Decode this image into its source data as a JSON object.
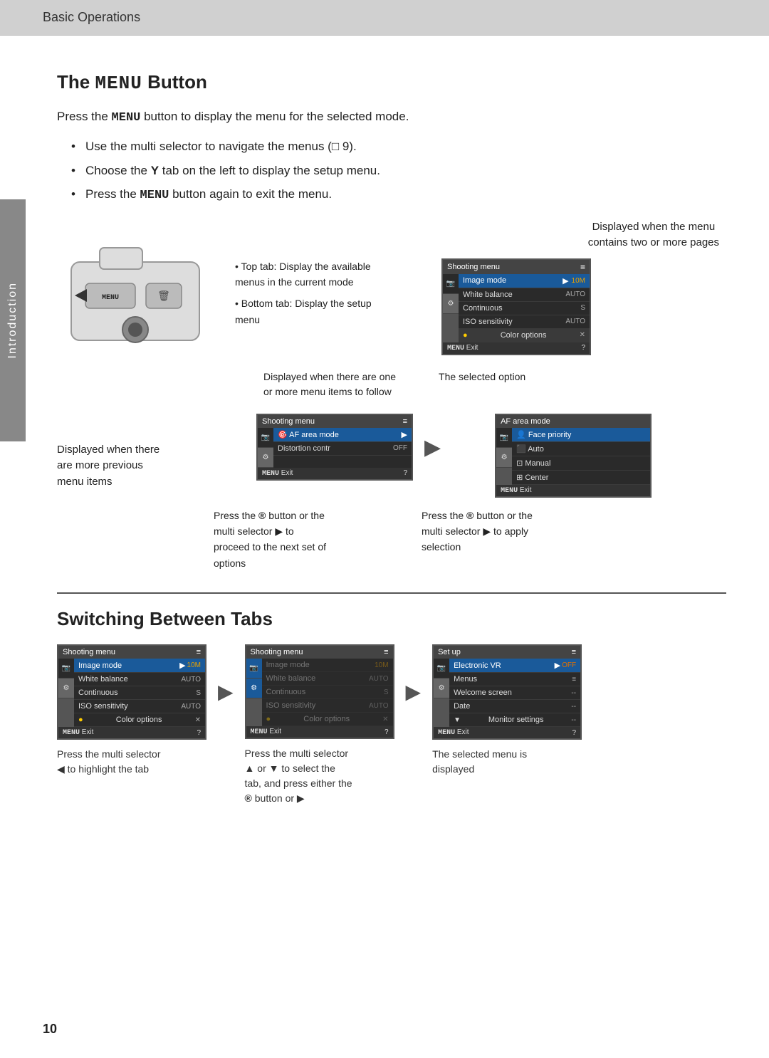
{
  "header": {
    "title": "Basic Operations"
  },
  "side_tab": {
    "label": "Introduction"
  },
  "section1": {
    "title_prefix": "The ",
    "title_menu_word": "MENU",
    "title_suffix": " Button",
    "intro": {
      "prefix": "Press the ",
      "menu_word": "MENU",
      "suffix": " button to display the menu for the selected mode."
    },
    "bullets": [
      "Use the multi selector to navigate the menus (□ 9).",
      "Choose the Y tab on the left to display the setup menu.",
      "Press the MENU button again to exit the menu."
    ],
    "tab_labels": [
      "Top tab: Display the available menus in the current mode",
      "Bottom tab: Display the setup menu"
    ],
    "top_annotation": {
      "line1": "Displayed when the menu",
      "line2": "contains two or more pages"
    },
    "bottom_annotations": {
      "left": "Displayed when there are one\nor more menu items to follow",
      "right": "The selected option"
    }
  },
  "menu_top": {
    "title": "Shooting menu",
    "items": [
      {
        "label": "Image mode",
        "value": "10M",
        "highlighted": true
      },
      {
        "label": "White balance",
        "value": "AUTO"
      },
      {
        "label": "Continuous",
        "value": "S"
      },
      {
        "label": "ISO sensitivity",
        "value": "AUTO"
      },
      {
        "label": "Color options",
        "value": "X"
      }
    ],
    "footer": "Exit",
    "footer_menu": "MENU",
    "footer_icon": "?"
  },
  "middle_section": {
    "left_annotation": {
      "line1": "Displayed when there",
      "line2": "are more previous",
      "line3": "menu items"
    },
    "menu_left": {
      "title": "Shooting menu",
      "items": [
        {
          "label": "AF area mode",
          "value": "",
          "highlighted": true
        },
        {
          "label": "Distortion contr",
          "value": "OFF"
        }
      ],
      "footer": "Exit",
      "footer_menu": "MENU",
      "footer_icon": "?"
    },
    "menu_right": {
      "title": "AF area mode",
      "items": [
        {
          "label": "Face priority",
          "value": "",
          "highlighted": true,
          "icon": "face"
        },
        {
          "label": "Auto",
          "value": ""
        },
        {
          "label": "Manual",
          "value": ""
        },
        {
          "label": "Center",
          "value": ""
        }
      ],
      "footer": "Exit",
      "footer_menu": "MENU"
    },
    "caption_left": {
      "line1": "Press the ® button or the",
      "line2": "multi selector ▶ to",
      "line3": "proceed to the next set of",
      "line4": "options"
    },
    "caption_right": {
      "line1": "Press the ® button or the",
      "line2": "multi selector ▶ to apply",
      "line3": "selection"
    }
  },
  "section2": {
    "title": "Switching Between Tabs",
    "menu1": {
      "title": "Shooting menu",
      "items": [
        {
          "label": "Image mode",
          "value": "10M",
          "arrow": true
        },
        {
          "label": "White balance",
          "value": "AUTO"
        },
        {
          "label": "Continuous",
          "value": "S"
        },
        {
          "label": "ISO sensitivity",
          "value": "AUTO"
        },
        {
          "label": "Color options",
          "value": "X"
        }
      ],
      "footer": "Exit",
      "footer_menu": "MENU",
      "footer_icon": "?"
    },
    "menu2": {
      "title": "Shooting menu",
      "items": [
        {
          "label": "Image mode",
          "value": "10M",
          "faded": true
        },
        {
          "label": "White balance",
          "value": "AUTO",
          "faded": true
        },
        {
          "label": "Continuous",
          "value": "S",
          "faded": true
        },
        {
          "label": "ISO sensitivity",
          "value": "AUTO",
          "faded": true
        },
        {
          "label": "Color options",
          "value": "X",
          "faded": true
        }
      ],
      "footer": "Exit",
      "footer_menu": "MENU",
      "footer_icon": "?"
    },
    "menu3": {
      "title": "Set up",
      "items": [
        {
          "label": "Electronic VR",
          "value": "OFF",
          "arrow": true
        },
        {
          "label": "Menus",
          "value": "≡"
        },
        {
          "label": "Welcome screen",
          "value": "--"
        },
        {
          "label": "Date",
          "value": "--"
        },
        {
          "label": "Monitor settings",
          "value": "--"
        }
      ],
      "footer": "Exit",
      "footer_menu": "MENU",
      "footer_icon": "?"
    },
    "caption1": {
      "line1": "Press the multi selector",
      "line2": "◀  to highlight the tab"
    },
    "caption2": {
      "line1": "Press the multi selector",
      "line2": "▲ or ▼ to select the",
      "line3": "tab, and press either the",
      "line4": "® button or ▶"
    },
    "caption3": {
      "line1": "The selected menu is",
      "line2": "displayed"
    }
  },
  "page_number": "10"
}
